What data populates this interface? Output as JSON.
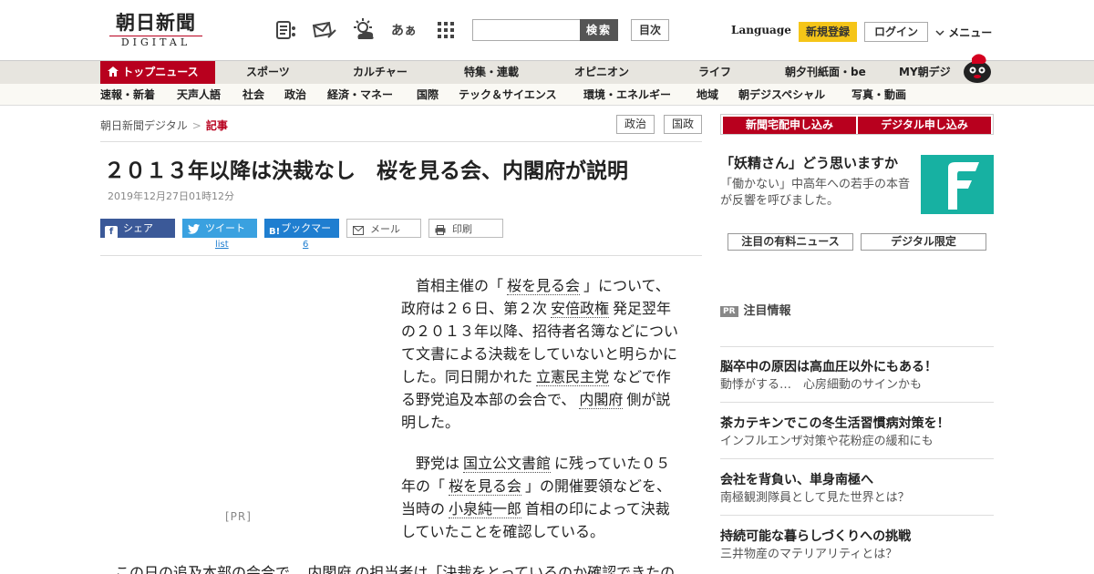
{
  "header": {
    "logo_main": "朝日新聞",
    "logo_sub": "DIGITAL",
    "icons": [
      "paper-icon",
      "mail-icon",
      "weather-icon",
      "font-size-icon",
      "grid-menu-icon"
    ],
    "font_size_glyph": "あぁ",
    "search_placeholder": "",
    "search_label": "検索",
    "toc_label": "目次",
    "language_label": "Language",
    "signup_label": "新規登録",
    "login_label": "ログイン",
    "menu_label": "メニュー"
  },
  "nav1": {
    "top_label": "トップニュース",
    "items": [
      "スポーツ",
      "カルチャー",
      "特集・連載",
      "オピニオン",
      "ライフ",
      "朝夕刊紙面・be",
      "MY朝デジ"
    ]
  },
  "nav2": {
    "items": [
      "速報・新着",
      "天声人語",
      "社会",
      "政治",
      "経済・マネー",
      "国際",
      "テック＆サイエンス",
      "環境・エネルギー",
      "地域",
      "朝デジスペシャル",
      "写真・動画"
    ]
  },
  "breadcrumb": {
    "home": "朝日新聞デジタル",
    "separator": ">",
    "current": "記事"
  },
  "tags": [
    "政治",
    "国政"
  ],
  "article": {
    "title": "２０１３年以降は決裁なし　桜を見る会、内閣府が説明",
    "date": "2019年12月27日01時12分",
    "share": {
      "facebook": "シェア",
      "twitter": "ツイート",
      "hatena_glyph": "B!",
      "hatena": "ブックマーク",
      "mail": "メール",
      "print": "印刷",
      "twitter_count": "list",
      "hatena_count": "6"
    },
    "pr_label": "[PR]",
    "p1": {
      "a": "　首相主催の「",
      "k1": "桜を見る会",
      "b": "」について、政府は２６日、第２次",
      "k2": "安倍政権",
      "c": "発足翌年の２０１３年以降、招待者名簿などについて文書による決裁をしていないと明らかにした。同日開かれた",
      "k3": "立憲民主党",
      "d": "などで作る野党追及本部の会合で、",
      "k4": "内閣府",
      "e": "側が説明した。"
    },
    "p2": {
      "a": "　野党は",
      "k1": "国立公文書館",
      "b": "に残っていた０５年の「",
      "k2": "桜を見る会",
      "c": "」の開催要領などを、当時の",
      "k3": "小泉純一郎",
      "d": "首相の印によって決裁していたことを確認している。"
    },
    "p3": {
      "a": "この日の追及本部の会合で、",
      "k1": "内閣府",
      "b": "の担当者は「決裁をとっているのか確認できたの"
    }
  },
  "sidebar": {
    "subscribe_paper": "新聞宅配申し込み",
    "subscribe_digital": "デジタル申し込み",
    "ad_head": "「妖精さん」どう思いますか",
    "ad_text": "「働かない」中高年への若手の本音が反響を呼びました。",
    "tab_featured": "注目の有料ニュース",
    "tab_digital": "デジタル限定",
    "notice_badge": "PR",
    "notice_label": "注目情報",
    "pr_items": [
      {
        "headline": "脳卒中の原因は高血圧以外にもある！",
        "sub": "動悸がする…　心房細動のサインかも"
      },
      {
        "headline": "茶カテキンでこの冬生活習慣病対策を！",
        "sub": "インフルエンザ対策や花粉症の緩和にも"
      },
      {
        "headline": "会社を背負い、単身南極へ",
        "sub": "南極観測隊員として見た世界とは？"
      },
      {
        "headline": "持続可能な暮らしづくりへの挑戦",
        "sub": "三井物産のマテリアリティとは？"
      }
    ]
  },
  "colors": {
    "brand": "#b8001e",
    "signup": "#f5c518",
    "facebook": "#3b5998",
    "twitter": "#3aa1e0",
    "hatena": "#1f7ed0",
    "ad_bg": "#17b1a2"
  }
}
